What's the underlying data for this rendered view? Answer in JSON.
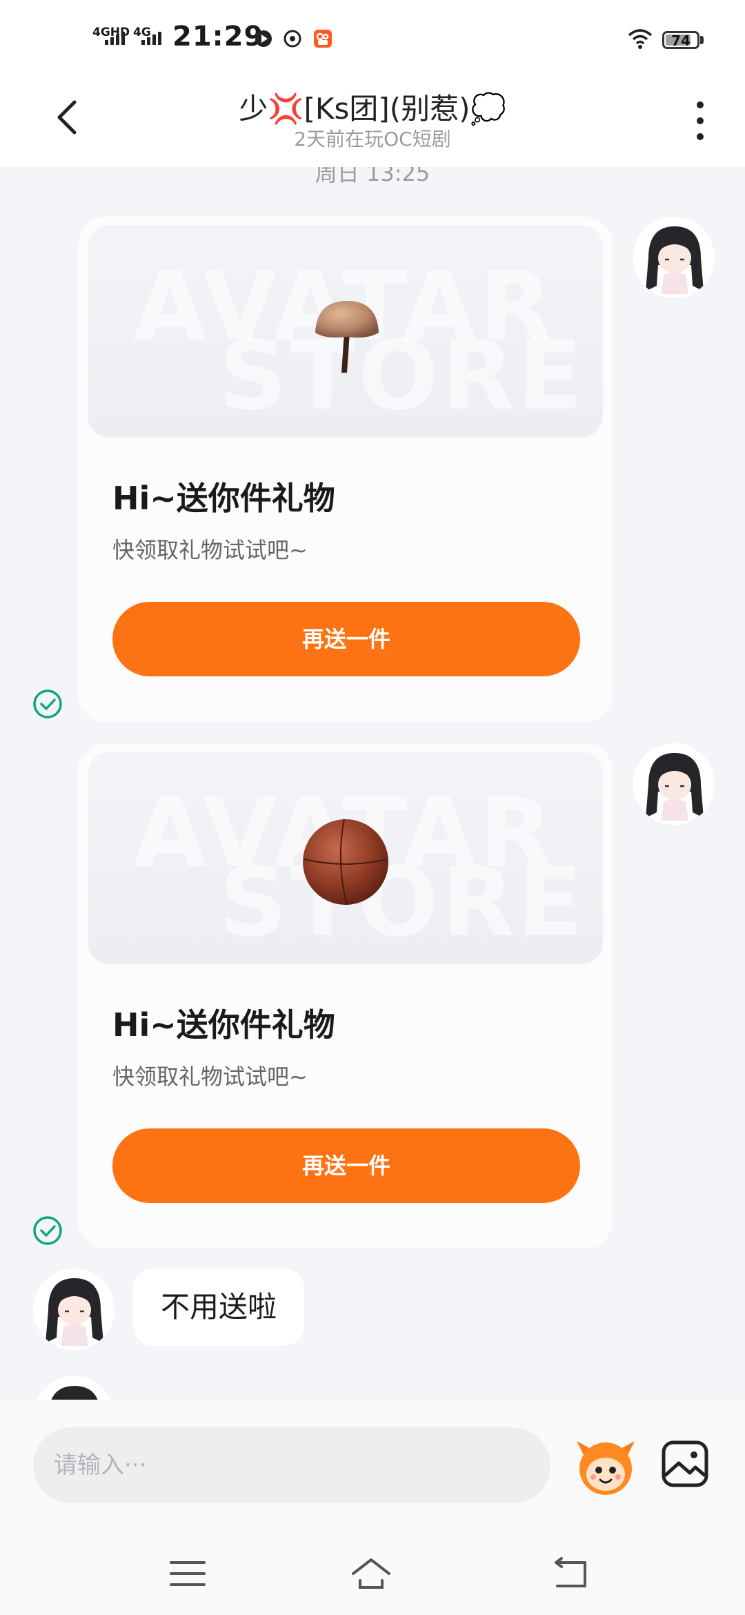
{
  "status_bar": {
    "network_1": "4GHD",
    "network_2": "4G",
    "time": "21:29",
    "battery": "74"
  },
  "header": {
    "title": "少💢[Ks团](别惹)💭",
    "subtitle": "2天前在玩OC短剧"
  },
  "chat": {
    "timestamp": "周日 13:25",
    "gift_cards": [
      {
        "title": "Hi~送你件礼物",
        "subtitle": "快领取礼物试试吧~",
        "button": "再送一件",
        "watermark_1": "AVATAR",
        "watermark_2": "STORE",
        "item_icon": "mushroom-icon"
      },
      {
        "title": "Hi~送你件礼物",
        "subtitle": "快领取礼物试试吧~",
        "button": "再送一件",
        "watermark_1": "AVATAR",
        "watermark_2": "STORE",
        "item_icon": "basketball-icon"
      }
    ],
    "received_message": "不用送啦"
  },
  "input": {
    "placeholder": "请输入···"
  },
  "colors": {
    "accent": "#fd7314",
    "read_check": "#13a37f",
    "background": "#f4f5f8"
  }
}
